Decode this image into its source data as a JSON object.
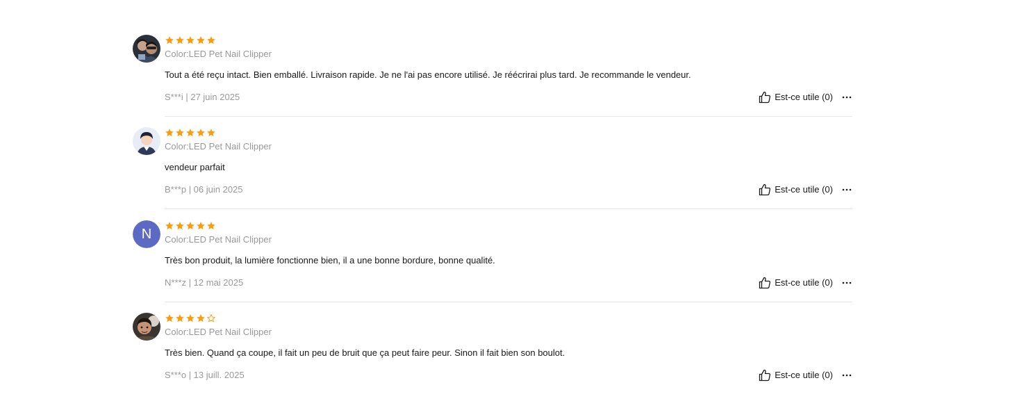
{
  "colors": {
    "star": "#FD9B0B",
    "star_empty_outline": "#FD9B0B",
    "muted_text": "#999999",
    "divider": "#e6e6e6"
  },
  "reviews": [
    {
      "avatar": "photo",
      "rating": 5,
      "color": "Color:LED Pet Nail Clipper",
      "text": "Tout a été reçu intact. Bien emballé. Livraison rapide. Je ne l'ai pas encore utilisé. Je réécrirai plus tard. Je recommande le vendeur.",
      "meta": "S***i | 27 juin 2025",
      "helpful": "Est-ce utile (0)"
    },
    {
      "avatar": "default-user",
      "rating": 5,
      "color": "Color:LED Pet Nail Clipper",
      "text": "vendeur parfait",
      "meta": "B***p | 06 juin 2025",
      "helpful": "Est-ce utile (0)"
    },
    {
      "avatar": "letter",
      "avatar_letter": "N",
      "avatar_bg": "#5c6ac4",
      "rating": 5,
      "color": "Color:LED Pet Nail Clipper",
      "text": "Très bon produit, la lumière fonctionne bien, il a une bonne bordure, bonne qualité.",
      "meta": "N***z | 12 mai 2025",
      "helpful": "Est-ce utile (0)"
    },
    {
      "avatar": "photo",
      "rating": 4,
      "color": "Color:LED Pet Nail Clipper",
      "text": "Très bien. Quand ça coupe, il fait un peu de bruit que ça peut faire peur. Sinon il fait bien son boulot.",
      "meta": "S***o | 13 juill. 2025",
      "helpful": "Est-ce utile (0)"
    }
  ]
}
